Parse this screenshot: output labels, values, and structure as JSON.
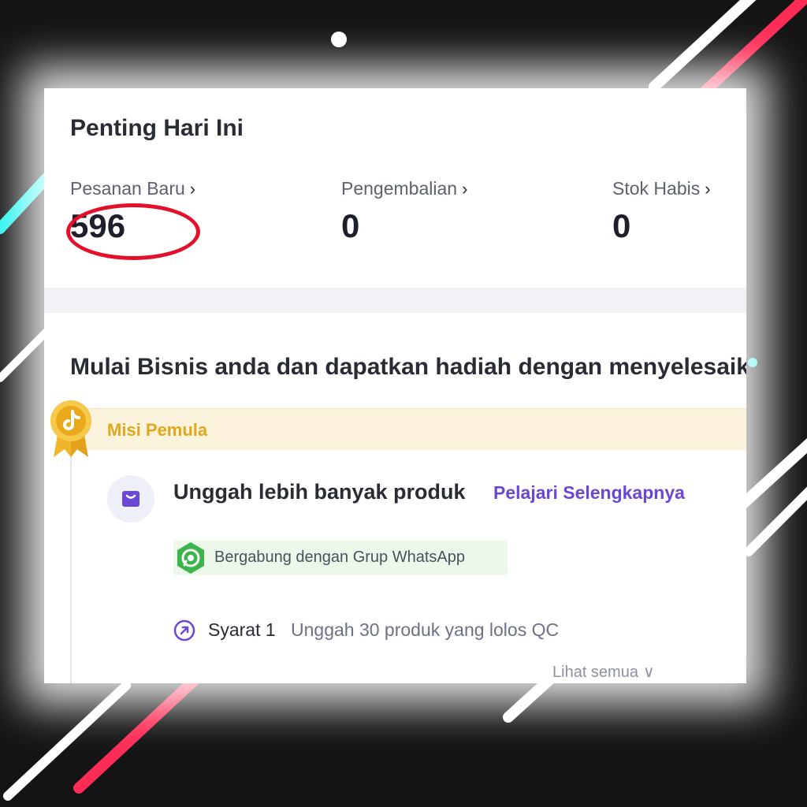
{
  "today": {
    "title": "Penting Hari Ini",
    "stats": [
      {
        "label": "Pesanan Baru",
        "value": "596",
        "highlighted": true
      },
      {
        "label": "Pengembalian",
        "value": "0"
      },
      {
        "label": "Stok Habis",
        "value": "0"
      }
    ]
  },
  "business": {
    "title": "Mulai Bisnis anda dan dapatkan hadiah dengan menyelesaikan",
    "mission": {
      "label": "Misi Pemula",
      "badge_icon": "tiktok-medal-icon",
      "task_title": "Unggah lebih banyak produk",
      "task_link": "Pelajari Selengkapnya",
      "whatsapp": "Bergabung dengan Grup WhatsApp",
      "requirement_label": "Syarat 1",
      "requirement_text": "Unggah 30 produk yang lolos QC",
      "see_all": "Lihat semua"
    }
  },
  "colors": {
    "accent": "#6b47d6",
    "mission": "#e0a81e",
    "highlight": "#e4102a",
    "stripe_red": "#fe2c55",
    "stripe_cyan": "#25f4ee"
  }
}
